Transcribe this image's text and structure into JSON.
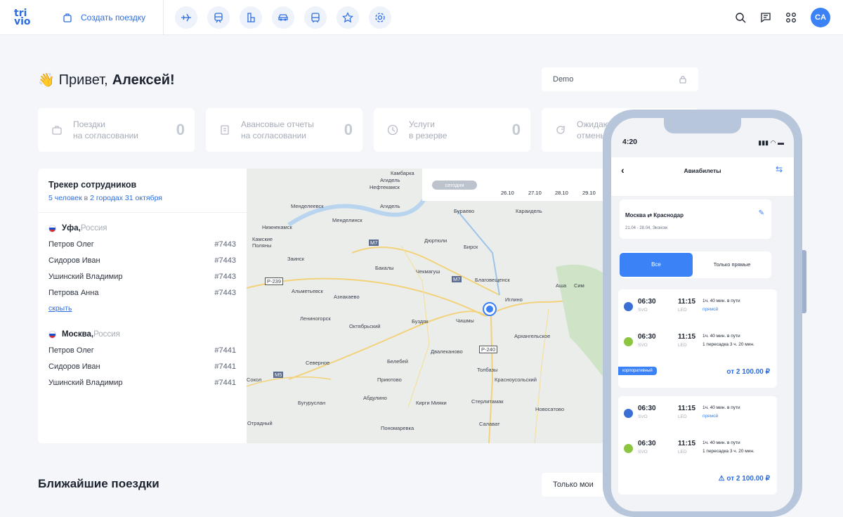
{
  "app": {
    "logo_line1": "tri",
    "logo_line2": "vio",
    "create_trip": "Создать поездку",
    "avatar": "CA"
  },
  "nav_icons": [
    "plane-icon",
    "train-icon",
    "hotel-icon",
    "car-icon",
    "bus-icon",
    "star-icon",
    "settings-icon"
  ],
  "greeting": {
    "hello": "Привет,",
    "name": "Алексей!"
  },
  "demo_select": {
    "value": "Demo"
  },
  "stats": [
    {
      "label1": "Поездки",
      "label2": "на согласовании",
      "value": "0"
    },
    {
      "label1": "Авансовые отчеты",
      "label2": "на согласовании",
      "value": "0"
    },
    {
      "label1": "Услуги",
      "label2": "в резерве",
      "value": "0"
    },
    {
      "label1": "Ожидают",
      "label2": "отмены",
      "value": ""
    }
  ],
  "tracker": {
    "title": "Трекер сотрудников",
    "sub_a": "5 человек",
    "sub_b": " в ",
    "sub_c": "2 городах",
    "sub_d": " ",
    "sub_e": "31 октября",
    "hide": "скрыть",
    "cities": [
      {
        "city": "Уфа,",
        "country": " Россия",
        "employees": [
          {
            "name": "Петров Олег",
            "code": "#7443"
          },
          {
            "name": "Сидоров Иван",
            "code": "#7443"
          },
          {
            "name": "Ушинский Владимир",
            "code": "#7443"
          },
          {
            "name": "Петрова Анна",
            "code": "#7443"
          }
        ]
      },
      {
        "city": "Москва,",
        "country": " Россия",
        "employees": [
          {
            "name": "Петров Олег",
            "code": "#7441"
          },
          {
            "name": "Сидоров Иван",
            "code": "#7441"
          },
          {
            "name": "Ушинский Владимир",
            "code": "#7441"
          }
        ]
      }
    ]
  },
  "map": {
    "today": "сегодня",
    "dates": [
      "26.10",
      "27.10",
      "28.10",
      "29.10"
    ],
    "labels": [
      "Камбарка",
      "Агидель",
      "Нефтекамск",
      "Менделеевск",
      "Агидель",
      "Буpaeвo",
      "Караидель",
      "Нижнекамск",
      "Менделинск",
      "Камские Поляны",
      "Заинск",
      "M7",
      "Дюртюли",
      "Бирск",
      "Бакалы",
      "Чекмагуш",
      "P-239",
      "Альметьевск",
      "M7",
      "Благовещенск",
      "Аша",
      "Сим",
      "Азнакаево",
      "Иглино",
      "Лениногорск",
      "Октябрьский",
      "Буздяк",
      "Чишмы",
      "Архангельское",
      "P-240",
      "Двалеканово",
      "Белебей",
      "Толбазы",
      "Северное",
      "Приютово",
      "Красноусольский",
      "M5",
      "Сокол",
      "Бугуруслан",
      "Абдулино",
      "Кирги Мияки",
      "Стерлитамак",
      "Новосатово",
      "Отрадный",
      "Пономаревка",
      "Салават"
    ]
  },
  "near": {
    "title": "Ближайшие поездки",
    "filter": "Только мои"
  },
  "phone": {
    "time": "4:20",
    "title": "Авиабилеты",
    "route": "Москва ⇄ Краснодар",
    "route_sub": "21.04 - 28.04, Эконом",
    "seg_all": "Все",
    "seg_direct": "Только прямые",
    "cards": [
      {
        "flights": [
          {
            "dep": "06:30",
            "dep_ap": "SVO",
            "arr": "11:15",
            "arr_ap": "LED",
            "dur": "1ч. 40 мин. в пути",
            "stops": "прямой",
            "airline_color": "#3b6fd4"
          },
          {
            "dep": "06:30",
            "dep_ap": "SVO",
            "arr": "11:15",
            "arr_ap": "LED",
            "dur": "1ч. 40 мин. в пути",
            "stops": "1 пересадка 3 ч. 20 мин.",
            "airline_color": "#8cc63f"
          }
        ],
        "badge": "корпоративный",
        "price": "от 2 100.00 ₽"
      },
      {
        "flights": [
          {
            "dep": "06:30",
            "dep_ap": "SVO",
            "arr": "11:15",
            "arr_ap": "LED",
            "dur": "1ч. 40 мин. в пути",
            "stops": "прямой",
            "airline_color": "#3b6fd4"
          },
          {
            "dep": "06:30",
            "dep_ap": "SVO",
            "arr": "11:15",
            "arr_ap": "LED",
            "dur": "1ч. 40 мин. в пути",
            "stops": "1 пересадка 3 ч. 20 мин.",
            "airline_color": "#8cc63f"
          }
        ],
        "badge": "",
        "price": "⚠ от 2 100.00 ₽"
      }
    ]
  }
}
